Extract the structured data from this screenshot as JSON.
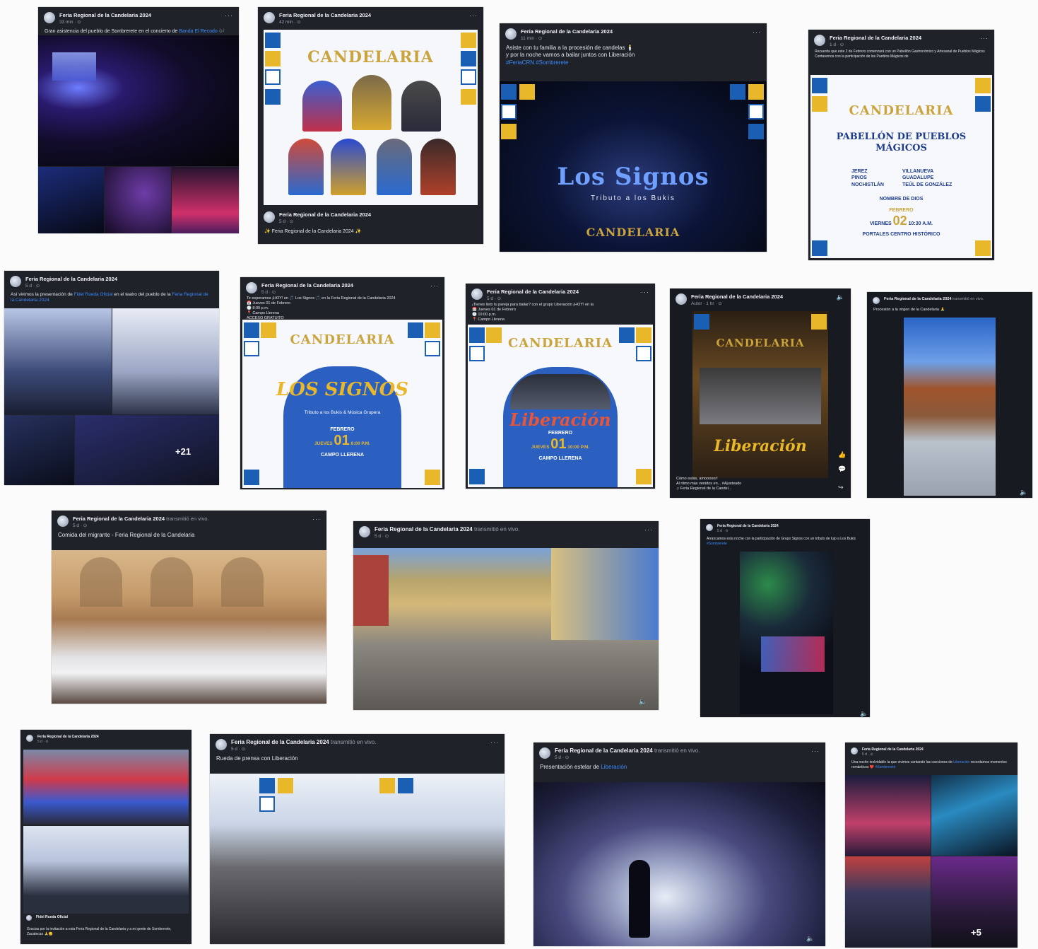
{
  "page_name": "Feria Regional de la Candelaria 2024",
  "live_suffix": "transmitió en vivo.",
  "posts": {
    "p1": {
      "time": "33 min · ⊙",
      "caption": "Gran asistencia del pueblo de Sombrerete en el concierto de",
      "tag": "Banda El Recodo 🎶"
    },
    "p2": {
      "time": "42 min · ⊙",
      "title": "CANDELARIA",
      "footer_page": "Feria Regional de la Candelaria 2024",
      "footer_time": "5 d · ⊙",
      "footer_caption": "✨ Feria Regional de la Candelaria 2024 ✨"
    },
    "p3": {
      "time": "11 min · ⊙",
      "caption1": "Asiste con tu familia a la procesión de candelas 🕯️",
      "caption2": "y por la noche vamos a bailar juntos con Liberación",
      "tags": "#FeriaCRN #Sombrerete",
      "overlay": "Los Signos",
      "overlay_sub": "Tributo a los Bukis",
      "logo": "CANDELARIA"
    },
    "p4": {
      "time": "1 d · ⊙",
      "caption": "Recuerda que este 2 de Febrero comenzará con un Pabellón Gastronómico y Artesanal de Pueblos Mágicos",
      "caption2": "Contaremos con la participación de los Pueblos Mágicos de",
      "title": "CANDELARIA",
      "pabellon": "PABELLÓN DE PUEBLOS MÁGICOS",
      "towns_left": [
        "JEREZ",
        "PINOS",
        "NOCHISTLÁN"
      ],
      "towns_right": [
        "VILLANUEVA",
        "GUADALUPE",
        "TEÚL DE GONZÁLEZ"
      ],
      "town_center": "NOMBRE DE DIOS",
      "month": "FEBRERO",
      "day_name": "VIERNES",
      "day": "02",
      "hour": "10:30 A.M.",
      "place": "PORTALES CENTRO HISTÓRICO"
    },
    "p5": {
      "time": "5 d · ⊙",
      "caption": "Así vivimos la presentación de",
      "tag": "Fidel Rueda Oficial",
      "caption_tail": "en el teatro del pueblo de la",
      "tag2": "Feria Regional de la Candelaria 2024",
      "more": "+21"
    },
    "p6": {
      "time": "5 d · ⊙",
      "caption": "Te esperamos ¡HOY! en 🎵 Los Signos 🎵 en la Feria Regional de la Candelaria 2024",
      "line1": "📅 Jueves 01 de Febrero",
      "line2": "🕗 8:00 p.m.",
      "line3": "📍 Campo Llerena",
      "line4": "ACCESO GRATUITO",
      "title": "CANDELARIA",
      "band": "LOS SIGNOS",
      "band_sub": "Tributo a los Bukis & Música Grupera",
      "month": "FEBRERO",
      "day_name": "JUEVES",
      "day": "01",
      "hour": "8:00 P.M.",
      "place": "CAMPO LLERENA"
    },
    "p7": {
      "time": "5 d · ⊙",
      "caption": "¡Tienes listo tu pareja para bailar? con el grupo Liberación ¡HOY! en la",
      "line1": "📅 Jueves 01 de Febrero",
      "line2": "🕙 10:00 p.m.",
      "line3": "📍 Campo Llerena",
      "title": "CANDELARIA",
      "band": "Liberación",
      "month": "FEBRERO",
      "day_name": "JUEVES",
      "day": "01",
      "hour": "10:00 P.M.",
      "place": "CAMPO LLERENA"
    },
    "p8": {
      "time": "Autor · 1 hr · ⊙",
      "title": "CANDELARIA",
      "band": "Liberación",
      "caption": "Cómo estás, amooooor!",
      "caption2": "Al ritmo más venidos en... #Ajusteado",
      "audio": "♫ Feria Regional de la Candel..."
    },
    "p9": {
      "time": "transmitió en vivo.",
      "caption": "Procesión a la virgen de la Candelaria 🙏"
    },
    "p10": {
      "time": "5 d · ⊙",
      "caption": "Comida del migrante - Feria Regional de la Candelaria"
    },
    "p11": {
      "time": "5 d · ⊙"
    },
    "p12": {
      "time": "5 d · ⊙",
      "caption": "Arrancamos esta noche con la participación de Grupo Signos con un tributo de lujo a Los Bukis",
      "tag": "#Sombrerete"
    },
    "p13": {
      "time": "5 d · ⊙",
      "footer_page": "Fidel Rueda Oficial",
      "caption": "Gracias por la invitación a esta Feria Regional de la Candelaria y a mi gente de Sombrerete, Zacatecas 🙏😊"
    },
    "p14": {
      "time": "5 d · ⊙",
      "caption": "Rueda de prensa con Liberación"
    },
    "p15": {
      "time": "5 d · ⊙",
      "caption": "Presentación estelar de",
      "tag": "Liberación"
    },
    "p16": {
      "time": "5 d · ⊙",
      "caption": "Una noche inolvidable la que vivimos cantando las canciones de",
      "tag": "Liberación",
      "caption_tail": "recordamos momentos románticos ❤️",
      "tag2": "#Sombrerete",
      "more": "+5"
    }
  },
  "colors": {
    "card_bg": "#1f2229",
    "link": "#3d8bfd",
    "gold": "#caa43c",
    "blue": "#1b5fb5",
    "yellow": "#e8b72a"
  }
}
